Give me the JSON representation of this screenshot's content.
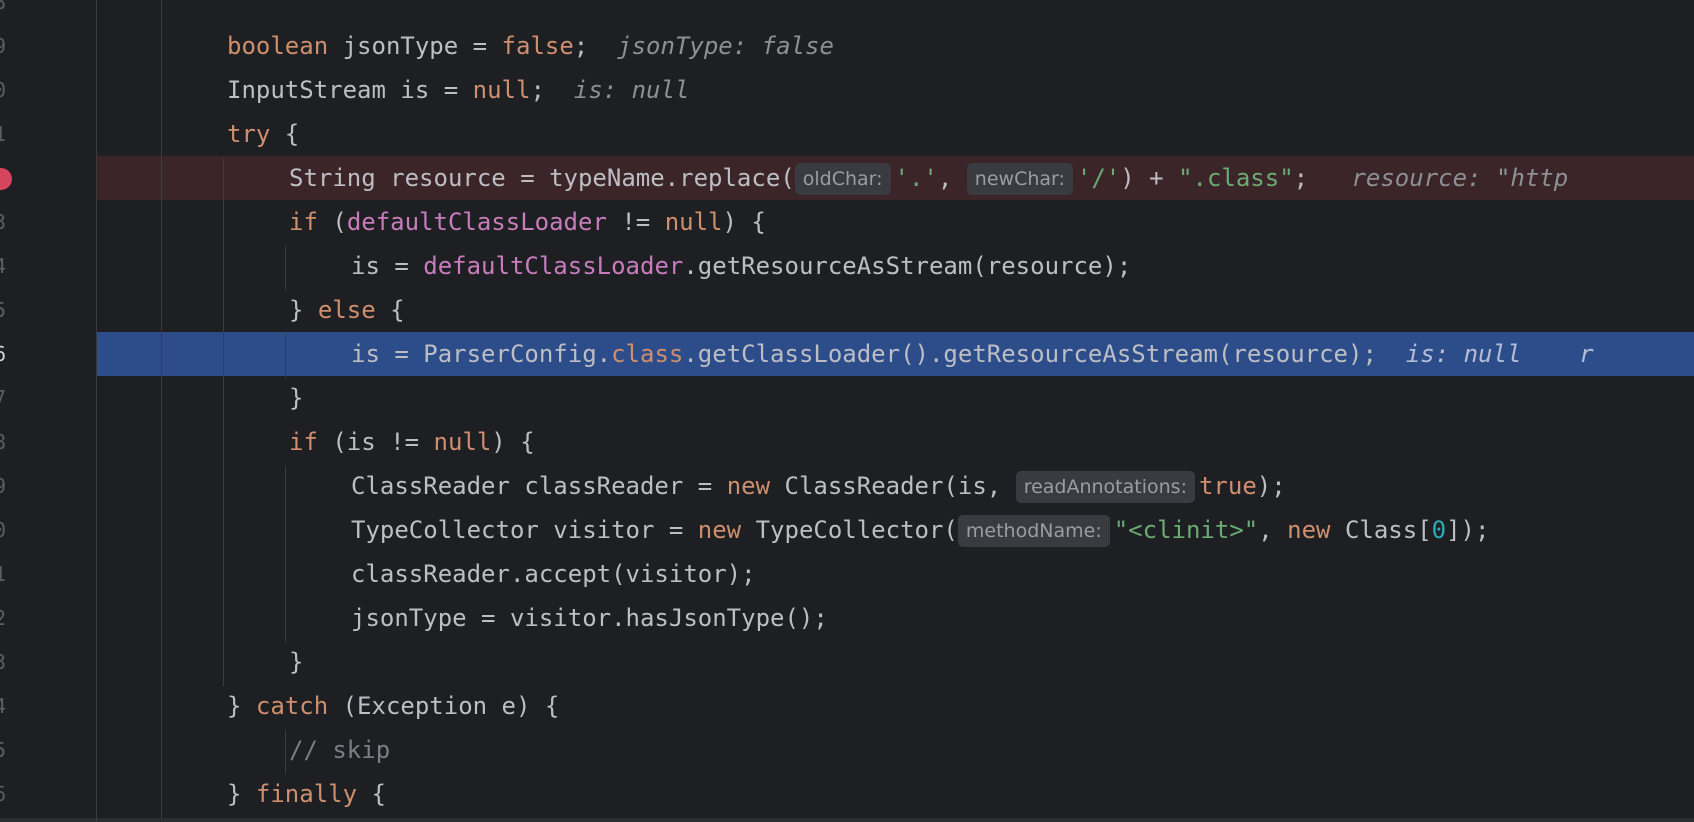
{
  "editor": {
    "lines": [
      {
        "num": "8",
        "indent": 0,
        "tokens": []
      },
      {
        "num": "9",
        "indent": 2,
        "tokens": [
          {
            "t": "boolean",
            "c": "kw"
          },
          {
            "t": " jsonType = "
          },
          {
            "t": "false",
            "c": "kw"
          },
          {
            "t": ";"
          },
          {
            "t": "  jsonType: false",
            "c": "dbg"
          }
        ]
      },
      {
        "num": "0",
        "indent": 2,
        "tokens": [
          {
            "t": "InputStream is = "
          },
          {
            "t": "null",
            "c": "kw"
          },
          {
            "t": ";"
          },
          {
            "t": "  is: null",
            "c": "dbg"
          }
        ]
      },
      {
        "num": "1",
        "indent": 2,
        "tokens": [
          {
            "t": "try",
            "c": "kw"
          },
          {
            "t": " {"
          }
        ]
      },
      {
        "num": "",
        "indent": 3,
        "state": "breakpoint",
        "tokens": [
          {
            "t": "String resource = typeName.replace("
          },
          {
            "t": "oldChar:",
            "c": "hint"
          },
          {
            "t": "'.'",
            "c": "str"
          },
          {
            "t": ", "
          },
          {
            "t": "newChar:",
            "c": "hint"
          },
          {
            "t": "'/'",
            "c": "str"
          },
          {
            "t": ") + "
          },
          {
            "t": "\".class\"",
            "c": "str"
          },
          {
            "t": ";"
          },
          {
            "t": "   resource: \"http",
            "c": "dbg"
          }
        ]
      },
      {
        "num": "3",
        "indent": 3,
        "tokens": [
          {
            "t": "if",
            "c": "kw"
          },
          {
            "t": " ("
          },
          {
            "t": "defaultClassLoader",
            "c": "fld"
          },
          {
            "t": " != "
          },
          {
            "t": "null",
            "c": "kw"
          },
          {
            "t": ") {"
          }
        ]
      },
      {
        "num": "4",
        "indent": 4,
        "tokens": [
          {
            "t": "is = "
          },
          {
            "t": "defaultClassLoader",
            "c": "fld"
          },
          {
            "t": ".getResourceAsStream(resource);"
          }
        ]
      },
      {
        "num": "5",
        "indent": 3,
        "tokens": [
          {
            "t": "} "
          },
          {
            "t": "else",
            "c": "kw"
          },
          {
            "t": " {"
          }
        ]
      },
      {
        "num": "6",
        "indent": 4,
        "state": "current",
        "tokens": [
          {
            "t": "is = ParserConfig."
          },
          {
            "t": "class",
            "c": "kw"
          },
          {
            "t": ".getClassLoader().getResourceAsStream(resource);"
          },
          {
            "t": "  is: null    r",
            "c": "dbg"
          }
        ]
      },
      {
        "num": "7",
        "indent": 3,
        "tokens": [
          {
            "t": "}"
          }
        ]
      },
      {
        "num": "8",
        "indent": 3,
        "tokens": [
          {
            "t": "if",
            "c": "kw"
          },
          {
            "t": " (is != "
          },
          {
            "t": "null",
            "c": "kw"
          },
          {
            "t": ") {"
          }
        ]
      },
      {
        "num": "9",
        "indent": 4,
        "tokens": [
          {
            "t": "ClassReader classReader = "
          },
          {
            "t": "new",
            "c": "kw"
          },
          {
            "t": " ClassReader(is, "
          },
          {
            "t": "readAnnotations:",
            "c": "hint"
          },
          {
            "t": "true",
            "c": "kw"
          },
          {
            "t": ");"
          }
        ]
      },
      {
        "num": "0",
        "indent": 4,
        "tokens": [
          {
            "t": "TypeCollector visitor = "
          },
          {
            "t": "new",
            "c": "kw"
          },
          {
            "t": " TypeCollector("
          },
          {
            "t": "methodName:",
            "c": "hint"
          },
          {
            "t": "\"<clinit>\"",
            "c": "str"
          },
          {
            "t": ", "
          },
          {
            "t": "new",
            "c": "kw"
          },
          {
            "t": " Class["
          },
          {
            "t": "0",
            "c": "num"
          },
          {
            "t": "]);"
          }
        ]
      },
      {
        "num": "1",
        "indent": 4,
        "tokens": [
          {
            "t": "classReader.accept(visitor);"
          }
        ]
      },
      {
        "num": "2",
        "indent": 4,
        "tokens": [
          {
            "t": "jsonType = visitor.hasJsonType();"
          }
        ]
      },
      {
        "num": "3",
        "indent": 3,
        "tokens": [
          {
            "t": "}"
          }
        ]
      },
      {
        "num": "4",
        "indent": 2,
        "tokens": [
          {
            "t": "} "
          },
          {
            "t": "catch",
            "c": "kw"
          },
          {
            "t": " (Exception e) {"
          }
        ]
      },
      {
        "num": "5",
        "indent": 3,
        "tokens": [
          {
            "t": "// skip",
            "c": "cmt"
          }
        ]
      },
      {
        "num": "6",
        "indent": 2,
        "tokens": [
          {
            "t": "} "
          },
          {
            "t": "finally",
            "c": "kw"
          },
          {
            "t": " {"
          }
        ]
      }
    ]
  },
  "icons": {
    "breakpoint": "breakpoint-check-icon"
  },
  "colors": {
    "background": "#1e1f22",
    "keyword": "#cf8e6d",
    "string": "#6aab73",
    "field": "#c77dbb",
    "number": "#2aacb8",
    "breakpoint_line": "#3b2529",
    "current_line": "#2d4d8a"
  }
}
